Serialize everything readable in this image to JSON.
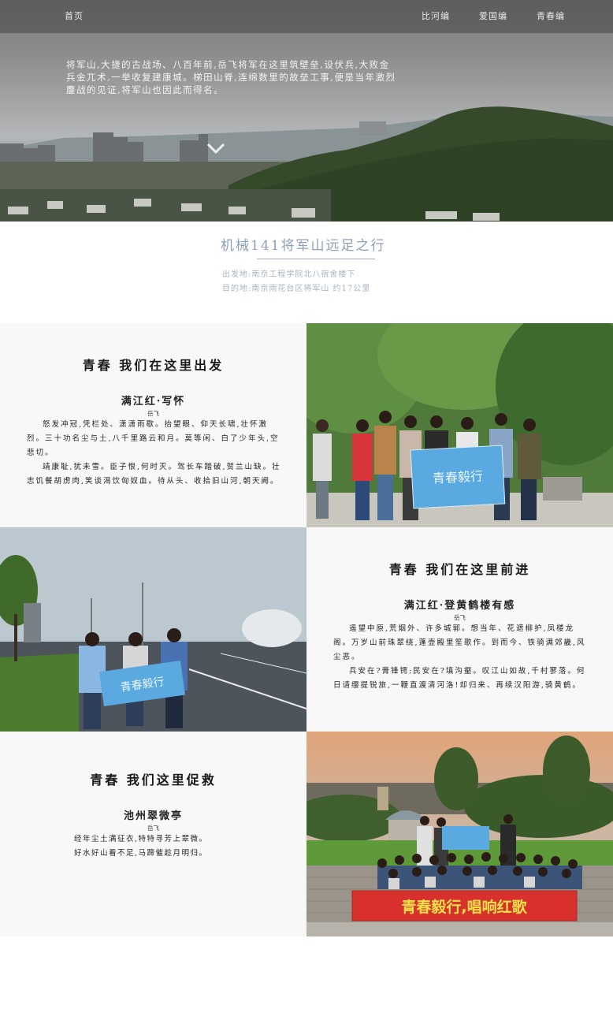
{
  "nav": {
    "home": "首页",
    "links": [
      "比河编",
      "爱国编",
      "青春编"
    ]
  },
  "hero": {
    "description": "将军山,大捷的古战场、八百年前,岳飞将军在这里筑壁垒,设伏兵,大败金兵金兀术,一举收复建康城。梯田山脊,连绵数里的故垒工事,便是当年激烈鏖战的见证,将军山也因此而得名。"
  },
  "intro": {
    "title": "机械141将军山远足之行",
    "departure": "出发地:南京工程学院北八宿舍楼下",
    "destination": "目的地:南京雨花台区将军山 约17公里"
  },
  "sections": [
    {
      "heading": "青春 我们在这里出发",
      "poem_title": "满江红·写怀",
      "author": "岳飞",
      "lines": [
        "怒发冲冠,凭栏处、潇潇雨歇。抬望眼、仰天长啸,壮怀激烈。三十功名尘与土,八千里路云和月。莫等闲、白了少年头,空悲切。",
        "靖康耻,犹未雪。臣子恨,何时灭。驾长车踏破,贺兰山缺。壮志饥餐胡虏肉,笑谈渴饮匈奴血。待从头、收拾旧山河,朝天阙。"
      ]
    },
    {
      "heading": "青春 我们在这里前进",
      "poem_title": "满江红·登黄鹤楼有感",
      "author": "岳飞",
      "lines": [
        "遥望中原,荒烟外、许多城郭。想当年、花遮柳护,凤楼龙阁。万岁山前珠翠绕,蓬壶殿里笙歌作。到而今、铁骑满郊畿,风尘恶。",
        "兵安在?膏锋锷;民安在?填沟壑。叹江山如故,千村寥落。何日请缨提锐旅,一鞭直渡清河洛!却归来、再续汉阳游,骑黄鹤。"
      ]
    },
    {
      "heading": "青春 我们这里促救",
      "poem_title": "池州翠微亭",
      "author": "岳飞",
      "lines": [
        "经年尘土满征衣,特特寻芳上翠微。",
        "好水好山看不足,马蹄催趁月明归。"
      ]
    }
  ],
  "photos": {
    "banner_group": "青春毅行",
    "banner_walk": "青春毅行",
    "banner_final": "青春毅行,唱响红歌"
  },
  "colors": {
    "banner_blue": "#5aa9e0",
    "banner_red": "#d8302c",
    "banner_text_yellow": "#f3e04a",
    "title_blue": "#8ea0b4"
  }
}
